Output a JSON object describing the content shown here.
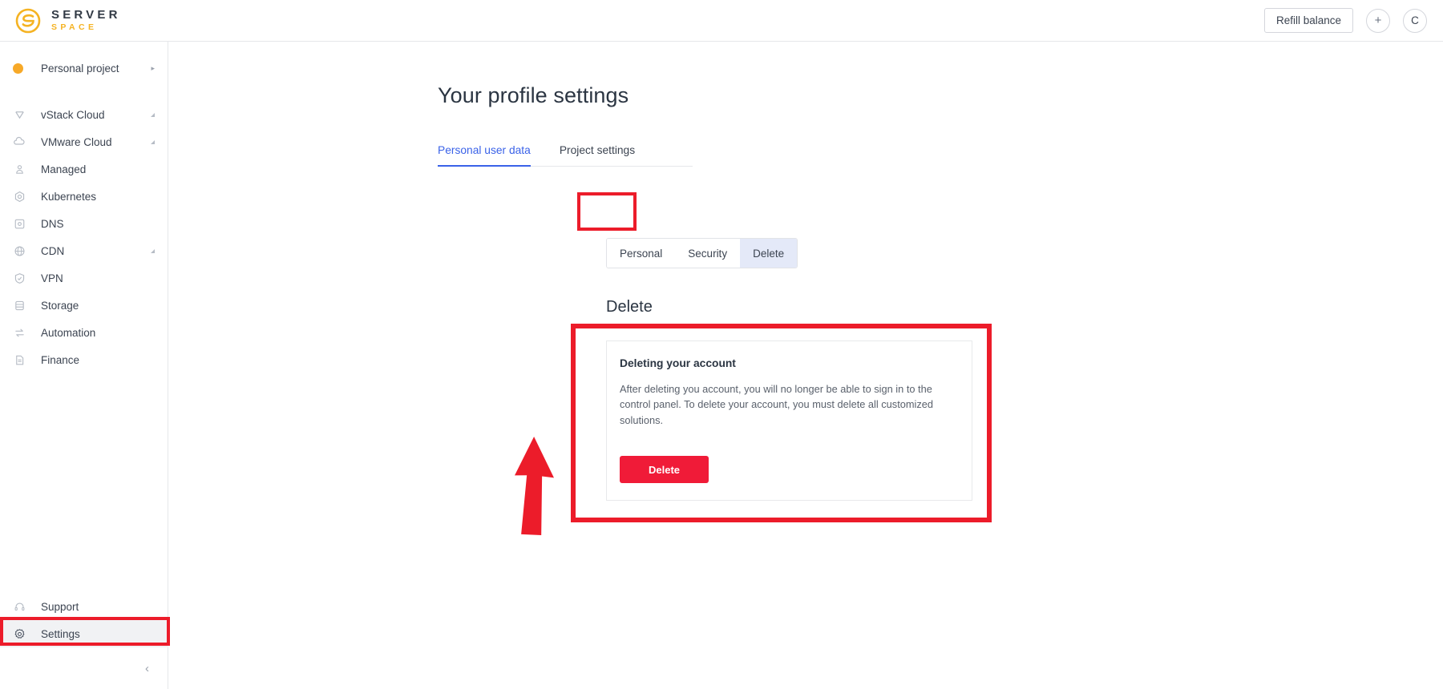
{
  "header": {
    "logo_line1": "SERVER",
    "logo_line2": "SPACE",
    "refill_label": "Refill balance",
    "add_label": "+",
    "avatar_label": "C"
  },
  "sidebar": {
    "project": {
      "label": "Personal project",
      "chevron": "▸"
    },
    "items": [
      {
        "label": "vStack Cloud",
        "icon": "vstack-icon",
        "expandable": true
      },
      {
        "label": "VMware Cloud",
        "icon": "cloud-icon",
        "expandable": true
      },
      {
        "label": "Managed",
        "icon": "managed-icon",
        "expandable": false
      },
      {
        "label": "Kubernetes",
        "icon": "kubernetes-icon",
        "expandable": false
      },
      {
        "label": "DNS",
        "icon": "dns-icon",
        "expandable": false
      },
      {
        "label": "CDN",
        "icon": "cdn-globe-icon",
        "expandable": true
      },
      {
        "label": "VPN",
        "icon": "vpn-shield-icon",
        "expandable": false
      },
      {
        "label": "Storage",
        "icon": "storage-icon",
        "expandable": false
      },
      {
        "label": "Automation",
        "icon": "automation-icon",
        "expandable": false
      },
      {
        "label": "Finance",
        "icon": "finance-document-icon",
        "expandable": false
      }
    ],
    "bottom_items": [
      {
        "label": "Support",
        "icon": "headset-icon",
        "active": false
      },
      {
        "label": "Settings",
        "icon": "gear-icon",
        "active": true
      }
    ],
    "collapse_icon": "‹"
  },
  "main": {
    "page_title": "Your profile settings",
    "tabs": [
      {
        "label": "Personal user data",
        "active": true
      },
      {
        "label": "Project settings",
        "active": false
      }
    ],
    "segmented": [
      {
        "label": "Personal",
        "selected": false
      },
      {
        "label": "Security",
        "selected": false
      },
      {
        "label": "Delete",
        "selected": true
      }
    ],
    "section_title": "Delete",
    "card": {
      "title": "Deleting your account",
      "text": "After deleting you account, you will no longer be able to sign in to the control panel. To delete your account, you must delete all customized solutions.",
      "button_label": "Delete"
    }
  },
  "colors": {
    "accent_blue": "#3a62e8",
    "brand_yellow": "#f5b323",
    "danger_red": "#f01b38",
    "annotation_red": "#ec1c2a",
    "project_dot": "#f7a928"
  }
}
